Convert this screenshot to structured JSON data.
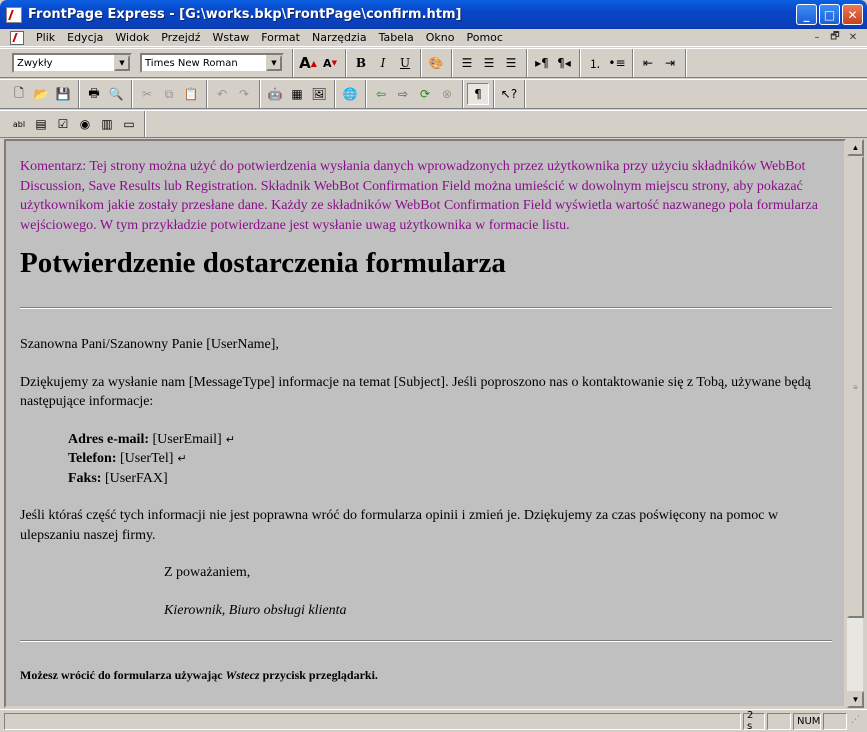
{
  "window": {
    "title": "FrontPage Express - [G:\\works.bkp\\FrontPage\\confirm.htm]",
    "buttons": {
      "minimize": "_",
      "maximize": "□",
      "close": "✕"
    }
  },
  "menubar": {
    "items": [
      "Plik",
      "Edycja",
      "Widok",
      "Przejdź",
      "Wstaw",
      "Format",
      "Narzędzia",
      "Tabela",
      "Okno",
      "Pomoc"
    ],
    "mdi": {
      "minimize": "–",
      "restore": "🗗",
      "close": "✕"
    }
  },
  "toolbar_format": {
    "style_value": "Zwykły",
    "font_value": "Times New Roman"
  },
  "document": {
    "comment": "Komentarz: Tej strony można użyć do potwierdzenia wysłania danych wprowadzonych przez użytkownika przy użyciu składników WebBot Discussion, Save Results lub Registration. Składnik WebBot Confirmation Field można umieścić w dowolnym miejscu strony, aby pokazać użytkownikom jakie zostały przesłane dane. Każdy ze składników WebBot Confirmation Field wyświetla wartość nazwanego pola formularza wejściowego. W tym przykładzie potwierdzane jest wysłanie uwag użytkownika w formacie listu.",
    "heading": "Potwierdzenie dostarczenia formularza",
    "greeting": "Szanowna Pani/Szanowny Panie [UserName],",
    "thanks": "Dziękujemy za wysłanie nam [MessageType] informacje na temat [Subject]. Jeśli poproszono nas o kontaktowanie się z Tobą, używane będą następujące informacje:",
    "email_label": "Adres e-mail:",
    "email_value": " [UserEmail]",
    "phone_label": "Telefon:",
    "phone_value": " [UserTel]",
    "fax_label": "Faks:",
    "fax_value": " [UserFAX]",
    "correction": "Jeśli któraś część tych informacji nie jest poprawna wróć do formularza opinii i zmień je. Dziękujemy za czas poświęcony na pomoc w ulepszaniu naszej firmy.",
    "closing": "Z poważaniem,",
    "signature": "Kierownik, Biuro obsługi klienta",
    "footer_pre": "Możesz wrócić do formularza używając ",
    "footer_em": "Wstecz",
    "footer_post": " przycisk przeglądarki."
  },
  "statusbar": {
    "time": "2 s",
    "num": "NUM"
  }
}
